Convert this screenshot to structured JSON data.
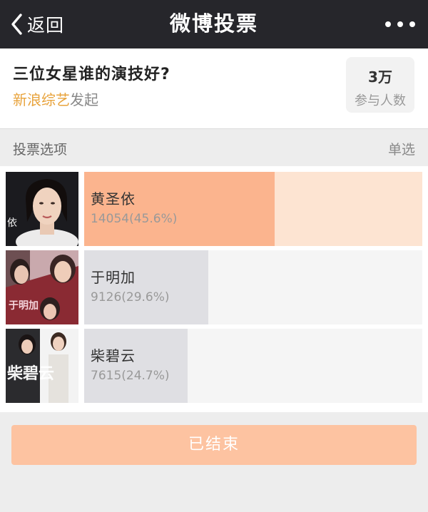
{
  "nav": {
    "back_label": "返回",
    "title": "微博投票"
  },
  "poll": {
    "question": "三位女星谁的演技好?",
    "initiator_org": "新浪综艺",
    "initiator_suffix": "发起",
    "participants_value": "3万",
    "participants_label": "参与人数"
  },
  "section": {
    "label": "投票选项",
    "mode": "单选"
  },
  "options": [
    {
      "name": "黄圣依",
      "stat": "14054(45.6%)",
      "votes": 14054,
      "percent": 45.6,
      "bar_color": "#fbb48e",
      "bar_bg": "#fde4d2"
    },
    {
      "name": "于明加",
      "stat": "9126(29.6%)",
      "votes": 9126,
      "percent": 29.6,
      "bar_color": "#dfdfe3",
      "bar_bg": "#f5f5f5"
    },
    {
      "name": "柴碧云",
      "stat": "7615(24.7%)",
      "votes": 7615,
      "percent": 24.7,
      "bar_color": "#dfdfe3",
      "bar_bg": "#f5f5f5"
    }
  ],
  "thumb_text": {
    "opt1": "依",
    "opt2": "于明加",
    "opt3": "柴碧云"
  },
  "footer": {
    "button_label": "已结束"
  }
}
